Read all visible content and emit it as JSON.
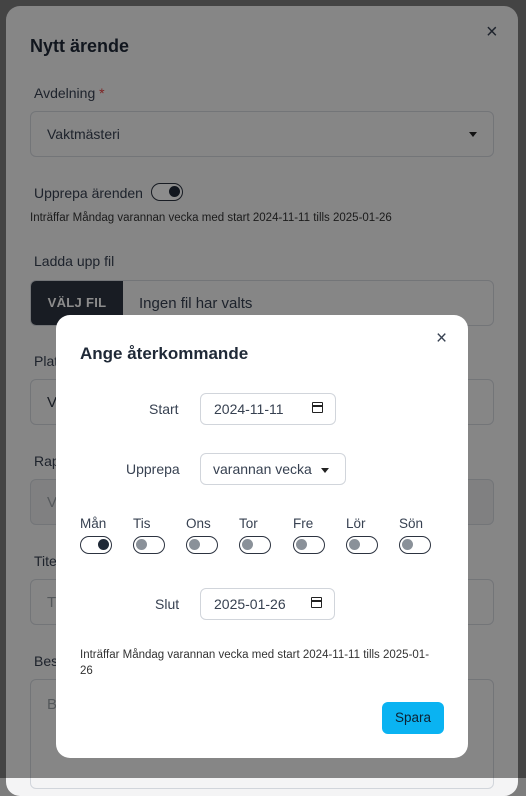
{
  "outer_modal": {
    "title": "Nytt ärende",
    "department": {
      "label": "Avdelning",
      "required_mark": "*",
      "value": "Vaktmästeri"
    },
    "repeat": {
      "label": "Upprepa ärenden",
      "enabled": true,
      "summary": "Inträffar Måndag varannan vecka med start 2024-11-11 tills 2025-01-26"
    },
    "upload": {
      "label": "Ladda upp fil",
      "button": "VÄLJ FIL",
      "status": "Ingen fil har valts"
    },
    "partial_labels": {
      "plat": "Plat",
      "rap": "Rap",
      "tite": "Tite",
      "bes": "Bes"
    },
    "partial_values": {
      "plat_value": "V",
      "rap_value": "V",
      "tite_value": "T",
      "bes_value": "B"
    }
  },
  "dialog": {
    "title": "Ange återkommande",
    "start": {
      "label": "Start",
      "value": "2024-11-11"
    },
    "repeat": {
      "label": "Upprepa",
      "value": "varannan vecka"
    },
    "days": [
      {
        "label": "Mån",
        "on": true
      },
      {
        "label": "Tis",
        "on": false
      },
      {
        "label": "Ons",
        "on": false
      },
      {
        "label": "Tor",
        "on": false
      },
      {
        "label": "Fre",
        "on": false
      },
      {
        "label": "Lör",
        "on": false
      },
      {
        "label": "Sön",
        "on": false
      }
    ],
    "end": {
      "label": "Slut",
      "value": "2025-01-26"
    },
    "summary": "Inträffar Måndag varannan vecka med start 2024-11-11 tills 2025-01-26",
    "save_button": "Spara"
  },
  "icons": {
    "close": "close-icon",
    "calendar": "calendar-icon",
    "dropdown": "chevron-down-icon"
  }
}
